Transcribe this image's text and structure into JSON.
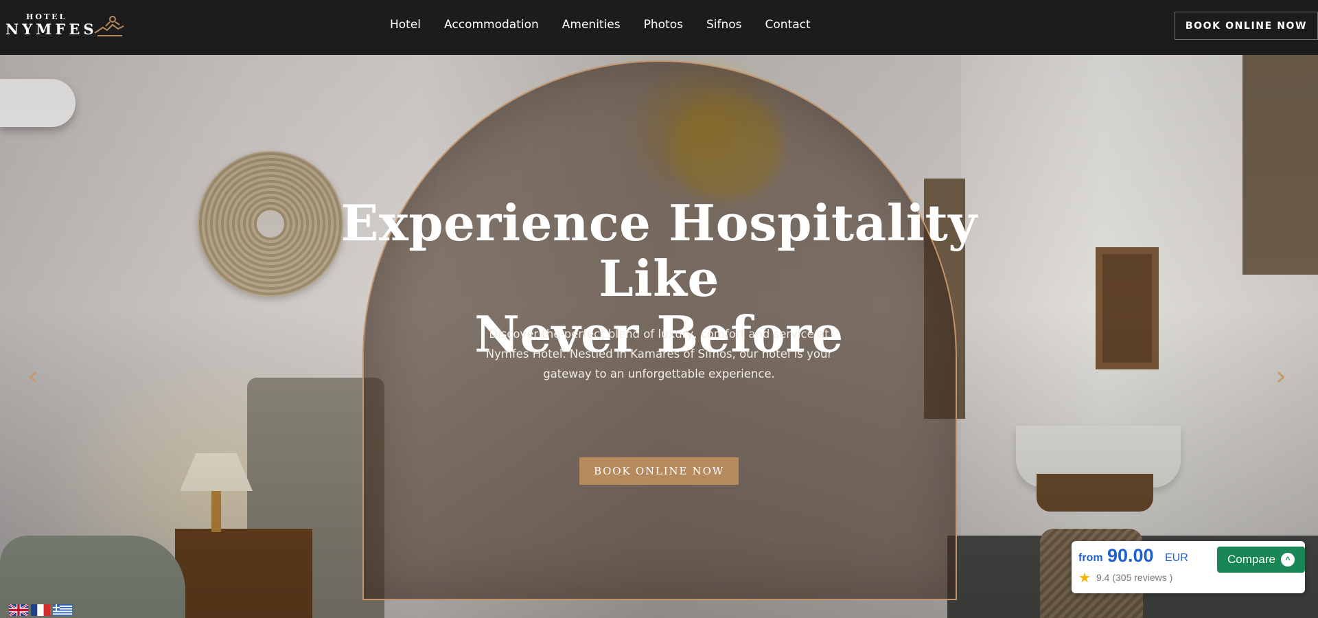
{
  "header": {
    "logo": {
      "small": "HOTEL",
      "big": "NYMFES"
    },
    "nav": [
      "Hotel",
      "Accommodation",
      "Amenities",
      "Photos",
      "Sifnos",
      "Contact"
    ],
    "book_button": "BOOK ONLINE NOW"
  },
  "hero": {
    "title_line1": "Experience Hospitality Like",
    "title_line2": "Never Before",
    "description": "Discover the perfect blend of luxury, comfort and service at Nymfes Hotel. Nestled in Kamares of Sifnos, our hotel is your gateway to an unforgettable experience.",
    "book_button": "BOOK ONLINE NOW",
    "prev_icon": "chevron-left-icon",
    "next_icon": "chevron-right-icon"
  },
  "flags": [
    "english-flag-icon",
    "french-flag-icon",
    "greek-flag-icon"
  ],
  "price_widget": {
    "from": "from",
    "price": "90.00",
    "currency": "EUR",
    "rating": "9.4 (305 reviews )",
    "compare": "Compare"
  },
  "colors": {
    "accent": "#b78a5d",
    "header_bg": "#1c1c1c",
    "price_blue": "#1f5fcf",
    "compare_green": "#188755"
  }
}
